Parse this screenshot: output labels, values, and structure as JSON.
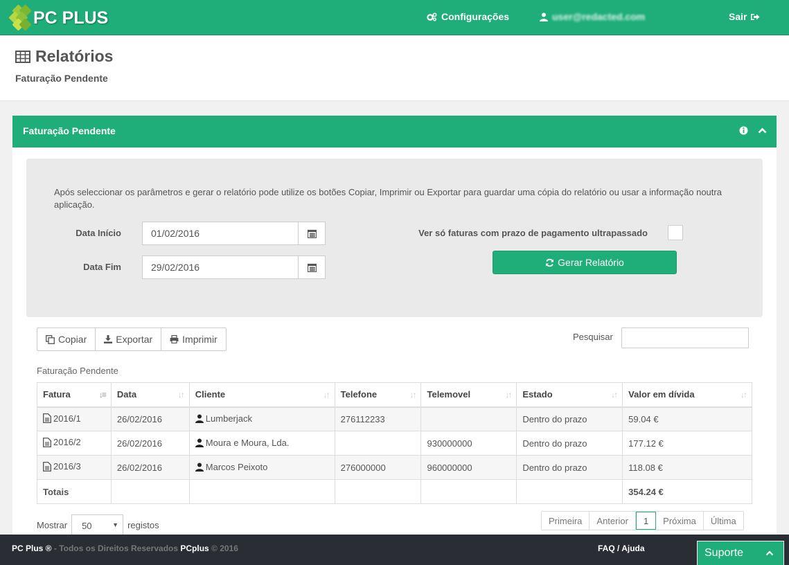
{
  "topbar": {
    "logo_text": "PC PLUS",
    "config_label": "Configurações",
    "user_email": "user@redacted.com",
    "logout_label": "Sair"
  },
  "page": {
    "title": "Relatórios",
    "subtitle": "Faturação Pendente"
  },
  "panel": {
    "title": "Faturação Pendente"
  },
  "filters": {
    "intro": "Após seleccionar os parâmetros e gerar o relatório pode utilize os botões Copiar, Imprimir ou Exportar para guardar uma cópia do relatório ou usar a informação noutra aplicação.",
    "start_label": "Data Início",
    "start_value": "01/02/2016",
    "end_label": "Data Fim",
    "end_value": "29/02/2016",
    "overdue_label": "Ver só faturas com prazo de pagamento ultrapassado",
    "overdue_checked": false,
    "generate_label": "Gerar Relatório"
  },
  "toolbar": {
    "copy_label": "Copiar",
    "export_label": "Exportar",
    "print_label": "Imprimir",
    "search_label": "Pesquisar",
    "search_value": ""
  },
  "table": {
    "caption": "Faturação Pendente",
    "columns": [
      "Fatura",
      "Data",
      "Cliente",
      "Telefone",
      "Telemovel",
      "Estado",
      "Valor em dívida"
    ],
    "rows": [
      {
        "fatura": "2016/1",
        "data": "26/02/2016",
        "cliente": "Lumberjack",
        "telefone": "276112233",
        "telemovel": "",
        "estado": "Dentro do prazo",
        "valor": "59.04 €"
      },
      {
        "fatura": "2016/2",
        "data": "26/02/2016",
        "cliente": "Moura e Moura, Lda.",
        "telefone": "",
        "telemovel": "930000000",
        "estado": "Dentro do prazo",
        "valor": "177.12 €"
      },
      {
        "fatura": "2016/3",
        "data": "26/02/2016",
        "cliente": "Marcos Peixoto",
        "telefone": "276000000",
        "telemovel": "960000000",
        "estado": "Dentro do prazo",
        "valor": "118.08 €"
      }
    ],
    "totals_label": "Totais",
    "totals_value": "354.24 €"
  },
  "pagination": {
    "show_label": "Mostrar",
    "page_size": "50",
    "records_label": "registos",
    "first": "Primeira",
    "prev": "Anterior",
    "current": "1",
    "next": "Próxima",
    "last": "Última"
  },
  "footer": {
    "brand": "PC Plus ®",
    "rights": " - Todos os Direitos Reservados ",
    "company": "PCplus",
    "year": " © 2016",
    "faq": "FAQ / Ajuda",
    "support": "Suporte"
  },
  "colors": {
    "accent": "#1fae7a",
    "footer": "#2a2d33"
  }
}
